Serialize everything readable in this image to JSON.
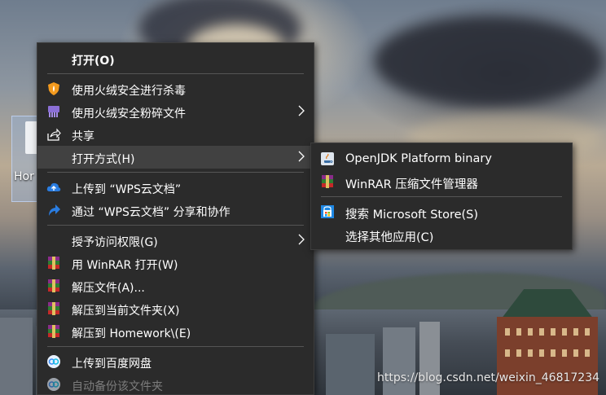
{
  "desktop": {
    "icon_label": "Hor"
  },
  "context_menu": {
    "items": [
      {
        "label": "打开(O)"
      },
      {
        "label": "使用火绒安全进行杀毒"
      },
      {
        "label": "使用火绒安全粉碎文件"
      },
      {
        "label": "共享"
      },
      {
        "label": "打开方式(H)"
      },
      {
        "label": "上传到 “WPS云文档”"
      },
      {
        "label": "通过 “WPS云文档” 分享和协作"
      },
      {
        "label": "授予访问权限(G)"
      },
      {
        "label": "用 WinRAR 打开(W)"
      },
      {
        "label": "解压文件(A)..."
      },
      {
        "label": "解压到当前文件夹(X)"
      },
      {
        "label": "解压到 Homework\\(E)"
      },
      {
        "label": "上传到百度网盘"
      },
      {
        "label": "自动备份该文件夹"
      }
    ]
  },
  "open_with_submenu": {
    "items": [
      {
        "label": "OpenJDK Platform binary"
      },
      {
        "label": "WinRAR 压缩文件管理器"
      },
      {
        "label": "搜索 Microsoft Store(S)"
      },
      {
        "label": "选择其他应用(C)"
      }
    ]
  },
  "watermark": "https://blog.csdn.net/weixin_46817234",
  "colors": {
    "menu_bg": "#2b2b2b",
    "menu_hover": "#414141",
    "menu_text": "#ffffff",
    "disabled_text": "#7c7c7c",
    "huorong_orange": "#f39a1e",
    "wps_blue": "#2a7de1"
  }
}
